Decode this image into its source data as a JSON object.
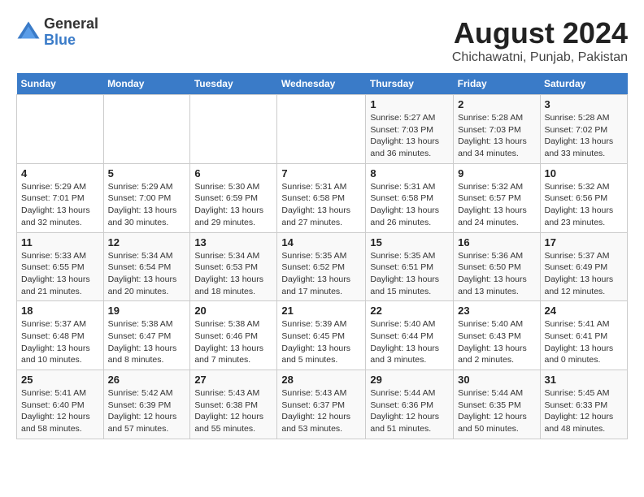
{
  "header": {
    "logo": {
      "general": "General",
      "blue": "Blue"
    },
    "month_title": "August 2024",
    "location": "Chichawatni, Punjab, Pakistan"
  },
  "days_of_week": [
    "Sunday",
    "Monday",
    "Tuesday",
    "Wednesday",
    "Thursday",
    "Friday",
    "Saturday"
  ],
  "weeks": [
    [
      {
        "day": "",
        "info": ""
      },
      {
        "day": "",
        "info": ""
      },
      {
        "day": "",
        "info": ""
      },
      {
        "day": "",
        "info": ""
      },
      {
        "day": "1",
        "info": "Sunrise: 5:27 AM\nSunset: 7:03 PM\nDaylight: 13 hours and 36 minutes."
      },
      {
        "day": "2",
        "info": "Sunrise: 5:28 AM\nSunset: 7:03 PM\nDaylight: 13 hours and 34 minutes."
      },
      {
        "day": "3",
        "info": "Sunrise: 5:28 AM\nSunset: 7:02 PM\nDaylight: 13 hours and 33 minutes."
      }
    ],
    [
      {
        "day": "4",
        "info": "Sunrise: 5:29 AM\nSunset: 7:01 PM\nDaylight: 13 hours and 32 minutes."
      },
      {
        "day": "5",
        "info": "Sunrise: 5:29 AM\nSunset: 7:00 PM\nDaylight: 13 hours and 30 minutes."
      },
      {
        "day": "6",
        "info": "Sunrise: 5:30 AM\nSunset: 6:59 PM\nDaylight: 13 hours and 29 minutes."
      },
      {
        "day": "7",
        "info": "Sunrise: 5:31 AM\nSunset: 6:58 PM\nDaylight: 13 hours and 27 minutes."
      },
      {
        "day": "8",
        "info": "Sunrise: 5:31 AM\nSunset: 6:58 PM\nDaylight: 13 hours and 26 minutes."
      },
      {
        "day": "9",
        "info": "Sunrise: 5:32 AM\nSunset: 6:57 PM\nDaylight: 13 hours and 24 minutes."
      },
      {
        "day": "10",
        "info": "Sunrise: 5:32 AM\nSunset: 6:56 PM\nDaylight: 13 hours and 23 minutes."
      }
    ],
    [
      {
        "day": "11",
        "info": "Sunrise: 5:33 AM\nSunset: 6:55 PM\nDaylight: 13 hours and 21 minutes."
      },
      {
        "day": "12",
        "info": "Sunrise: 5:34 AM\nSunset: 6:54 PM\nDaylight: 13 hours and 20 minutes."
      },
      {
        "day": "13",
        "info": "Sunrise: 5:34 AM\nSunset: 6:53 PM\nDaylight: 13 hours and 18 minutes."
      },
      {
        "day": "14",
        "info": "Sunrise: 5:35 AM\nSunset: 6:52 PM\nDaylight: 13 hours and 17 minutes."
      },
      {
        "day": "15",
        "info": "Sunrise: 5:35 AM\nSunset: 6:51 PM\nDaylight: 13 hours and 15 minutes."
      },
      {
        "day": "16",
        "info": "Sunrise: 5:36 AM\nSunset: 6:50 PM\nDaylight: 13 hours and 13 minutes."
      },
      {
        "day": "17",
        "info": "Sunrise: 5:37 AM\nSunset: 6:49 PM\nDaylight: 13 hours and 12 minutes."
      }
    ],
    [
      {
        "day": "18",
        "info": "Sunrise: 5:37 AM\nSunset: 6:48 PM\nDaylight: 13 hours and 10 minutes."
      },
      {
        "day": "19",
        "info": "Sunrise: 5:38 AM\nSunset: 6:47 PM\nDaylight: 13 hours and 8 minutes."
      },
      {
        "day": "20",
        "info": "Sunrise: 5:38 AM\nSunset: 6:46 PM\nDaylight: 13 hours and 7 minutes."
      },
      {
        "day": "21",
        "info": "Sunrise: 5:39 AM\nSunset: 6:45 PM\nDaylight: 13 hours and 5 minutes."
      },
      {
        "day": "22",
        "info": "Sunrise: 5:40 AM\nSunset: 6:44 PM\nDaylight: 13 hours and 3 minutes."
      },
      {
        "day": "23",
        "info": "Sunrise: 5:40 AM\nSunset: 6:43 PM\nDaylight: 13 hours and 2 minutes."
      },
      {
        "day": "24",
        "info": "Sunrise: 5:41 AM\nSunset: 6:41 PM\nDaylight: 13 hours and 0 minutes."
      }
    ],
    [
      {
        "day": "25",
        "info": "Sunrise: 5:41 AM\nSunset: 6:40 PM\nDaylight: 12 hours and 58 minutes."
      },
      {
        "day": "26",
        "info": "Sunrise: 5:42 AM\nSunset: 6:39 PM\nDaylight: 12 hours and 57 minutes."
      },
      {
        "day": "27",
        "info": "Sunrise: 5:43 AM\nSunset: 6:38 PM\nDaylight: 12 hours and 55 minutes."
      },
      {
        "day": "28",
        "info": "Sunrise: 5:43 AM\nSunset: 6:37 PM\nDaylight: 12 hours and 53 minutes."
      },
      {
        "day": "29",
        "info": "Sunrise: 5:44 AM\nSunset: 6:36 PM\nDaylight: 12 hours and 51 minutes."
      },
      {
        "day": "30",
        "info": "Sunrise: 5:44 AM\nSunset: 6:35 PM\nDaylight: 12 hours and 50 minutes."
      },
      {
        "day": "31",
        "info": "Sunrise: 5:45 AM\nSunset: 6:33 PM\nDaylight: 12 hours and 48 minutes."
      }
    ]
  ]
}
